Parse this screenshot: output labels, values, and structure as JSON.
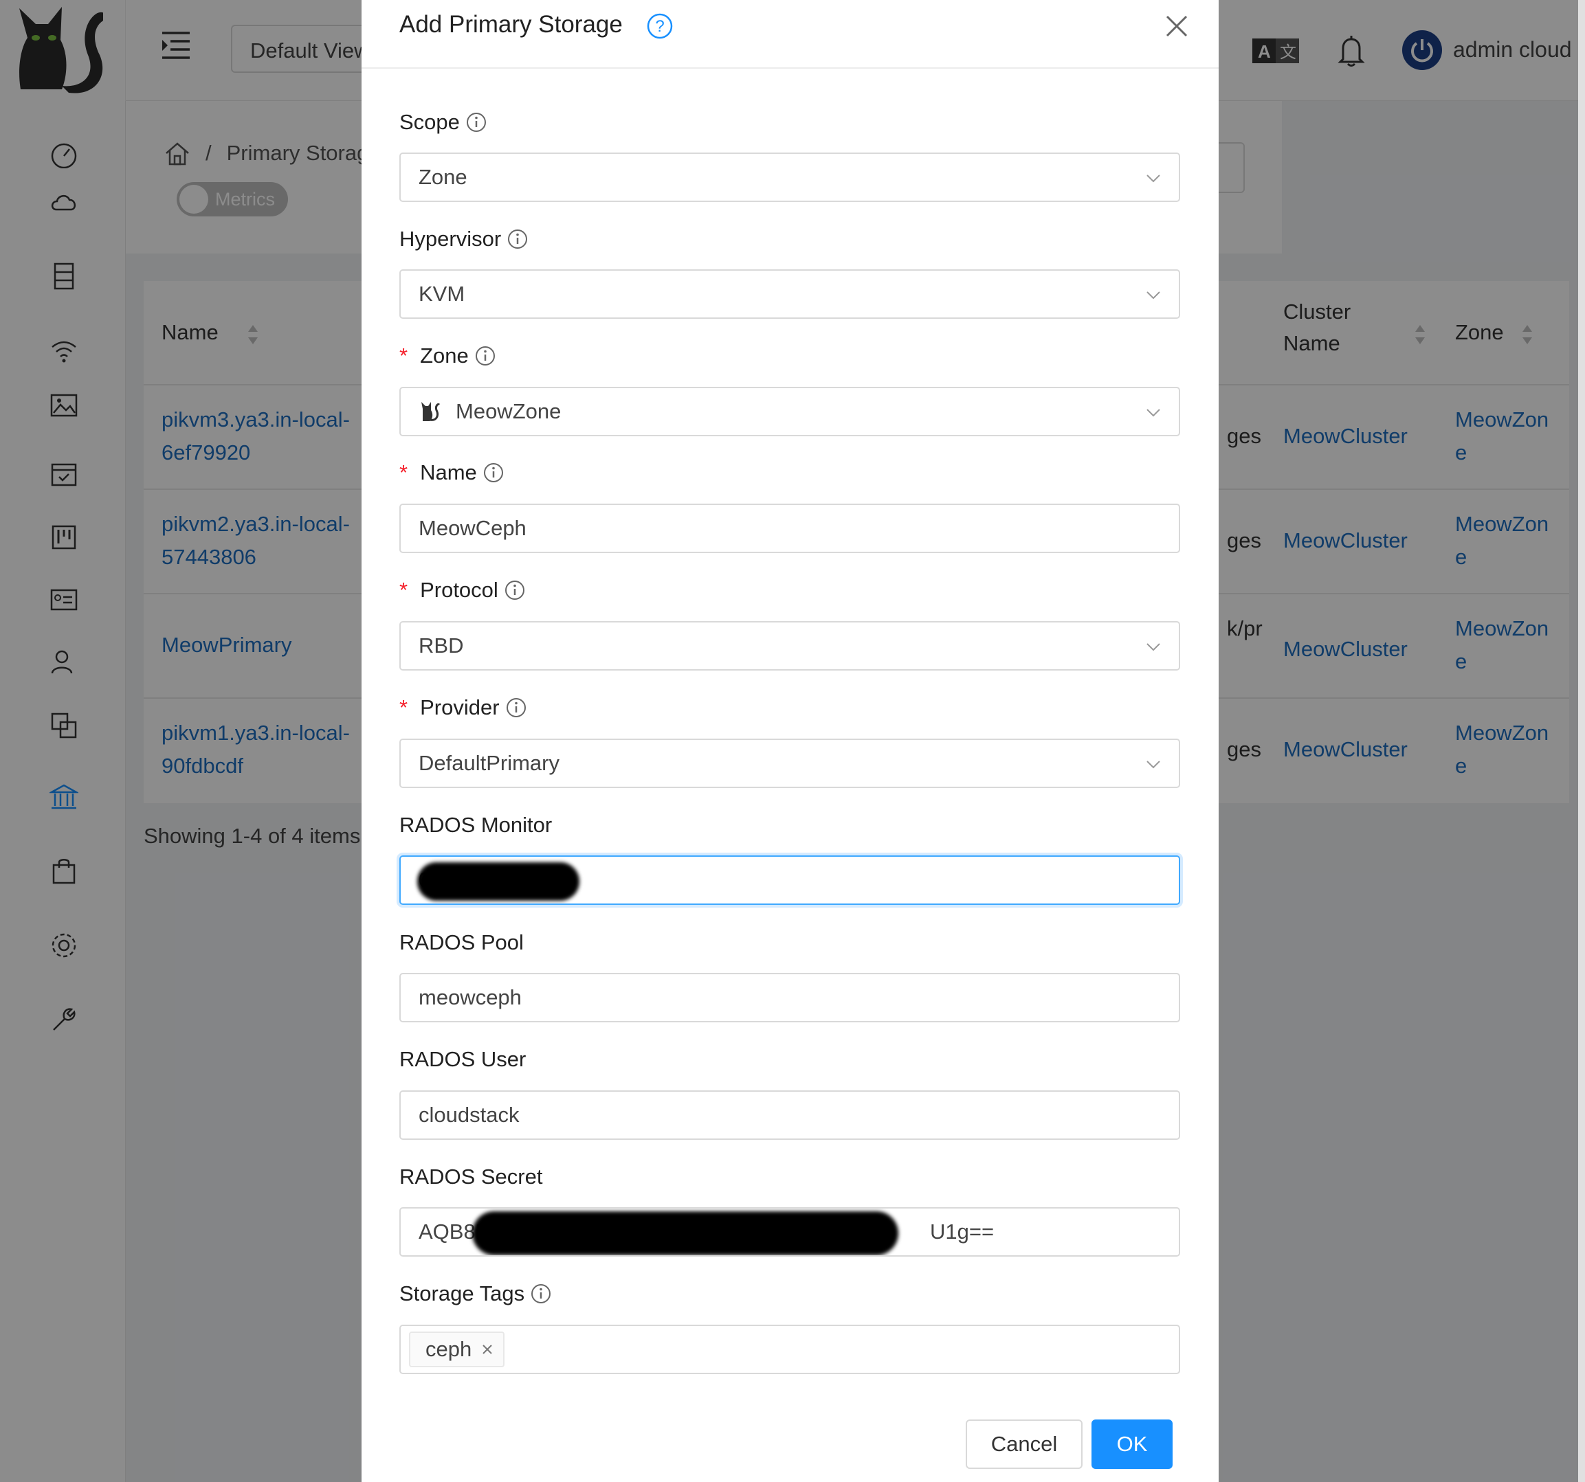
{
  "header": {
    "default_view": "Default View",
    "user_name": "admin cloud"
  },
  "breadcrumb": {
    "current": "Primary Storage"
  },
  "metrics_toggle": {
    "label": "Metrics"
  },
  "table": {
    "headers": {
      "name": "Name",
      "cluster_name_1": "Cluster",
      "cluster_name_2": "Name",
      "zone": "Zone"
    },
    "rows": [
      {
        "name_1": "pikvm3.ya3.in-local-",
        "name_2": "6ef79920",
        "path_fragment": "ges",
        "cluster": "MeowCluster",
        "zone_1": "MeowZon",
        "zone_2": "e"
      },
      {
        "name_1": "pikvm2.ya3.in-local-",
        "name_2": "57443806",
        "path_fragment": "ges",
        "cluster": "MeowCluster",
        "zone_1": "MeowZon",
        "zone_2": "e"
      },
      {
        "name_1": "MeowPrimary",
        "name_2": "",
        "path_fragment": "k/pr",
        "cluster": "MeowCluster",
        "zone_1": "MeowZon",
        "zone_2": "e"
      },
      {
        "name_1": "pikvm1.ya3.in-local-",
        "name_2": "90fdbcdf",
        "path_fragment": "ges",
        "cluster": "MeowCluster",
        "zone_1": "MeowZon",
        "zone_2": "e"
      }
    ],
    "showing": "Showing 1-4 of 4 items"
  },
  "modal": {
    "title": "Add Primary Storage",
    "fields": {
      "scope": {
        "label": "Scope",
        "value": "Zone"
      },
      "hypervisor": {
        "label": "Hypervisor",
        "value": "KVM"
      },
      "zone": {
        "label": "Zone",
        "value": "MeowZone",
        "required": true
      },
      "name": {
        "label": "Name",
        "value": "MeowCeph",
        "required": true
      },
      "protocol": {
        "label": "Protocol",
        "value": "RBD",
        "required": true
      },
      "provider": {
        "label": "Provider",
        "value": "DefaultPrimary",
        "required": true
      },
      "rados_monitor": {
        "label": "RADOS Monitor",
        "value_visible": "0"
      },
      "rados_pool": {
        "label": "RADOS Pool",
        "value": "meowceph"
      },
      "rados_user": {
        "label": "RADOS User",
        "value": "cloudstack"
      },
      "rados_secret": {
        "label": "RADOS Secret",
        "value_start": "AQB8F",
        "value_end": "U1g=="
      },
      "storage_tags": {
        "label": "Storage Tags",
        "tags": [
          "ceph"
        ]
      }
    },
    "required_mark": "*",
    "cancel_label": "Cancel",
    "ok_label": "OK"
  },
  "colors": {
    "primary": "#1890ff",
    "link": "#1e6ec0",
    "required": "#f5222d",
    "overlay": "rgba(0,0,0,0.45)"
  }
}
